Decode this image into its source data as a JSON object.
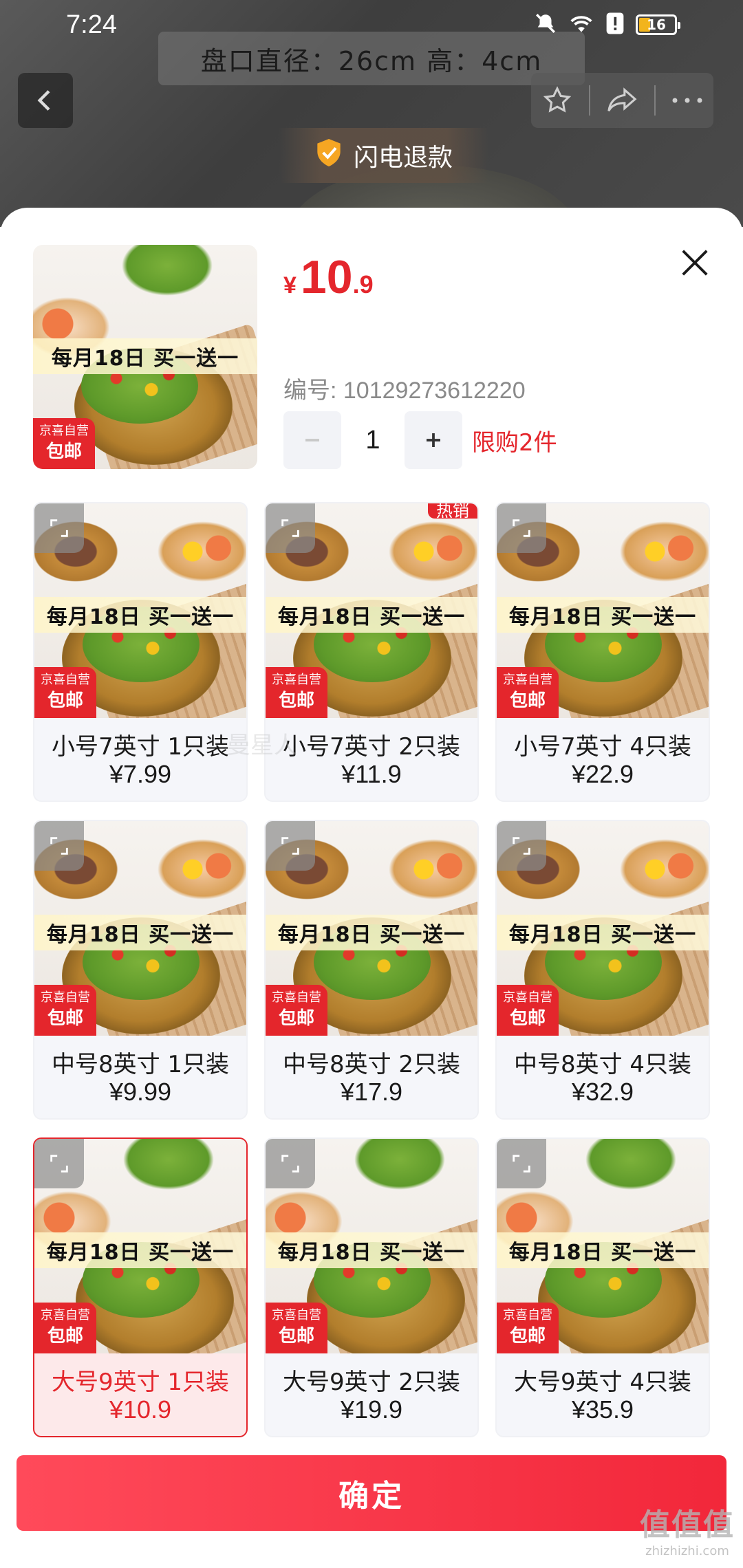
{
  "status_bar": {
    "time": "7:24",
    "battery": "16"
  },
  "background": {
    "caption": "盘口直径：26cm   高：4cm",
    "refund_label": "闪电退款"
  },
  "sheet": {
    "price": {
      "currency": "¥",
      "integer": "10",
      "decimal": ".9"
    },
    "sku_code": "编号: 10129273612220",
    "quantity": "1",
    "limit_text": "限购2件",
    "promo_text": "每月18日 买一送一",
    "badge_top": "京喜自营",
    "badge_bottom": "包邮",
    "hot_badge": "热销",
    "options": [
      {
        "label": "小号7英寸 1只装",
        "price": "¥7.99"
      },
      {
        "label": "小号7英寸 2只装",
        "price": "¥11.9"
      },
      {
        "label": "小号7英寸 4只装",
        "price": "¥22.9"
      },
      {
        "label": "中号8英寸 1只装",
        "price": "¥9.99"
      },
      {
        "label": "中号8英寸 2只装",
        "price": "¥17.9"
      },
      {
        "label": "中号8英寸 4只装",
        "price": "¥32.9"
      },
      {
        "label": "大号9英寸 1只装",
        "price": "¥10.9"
      },
      {
        "label": "大号9英寸 2只装",
        "price": "¥19.9"
      },
      {
        "label": "大号9英寸 4只装",
        "price": "¥35.9"
      }
    ],
    "selected_index": 6,
    "confirm_label": "确定"
  },
  "watermark": {
    "main": "值值值",
    "sub": "zhizhizhi.com"
  },
  "colors": {
    "accent": "#e4262c",
    "button": "#f2273a"
  }
}
